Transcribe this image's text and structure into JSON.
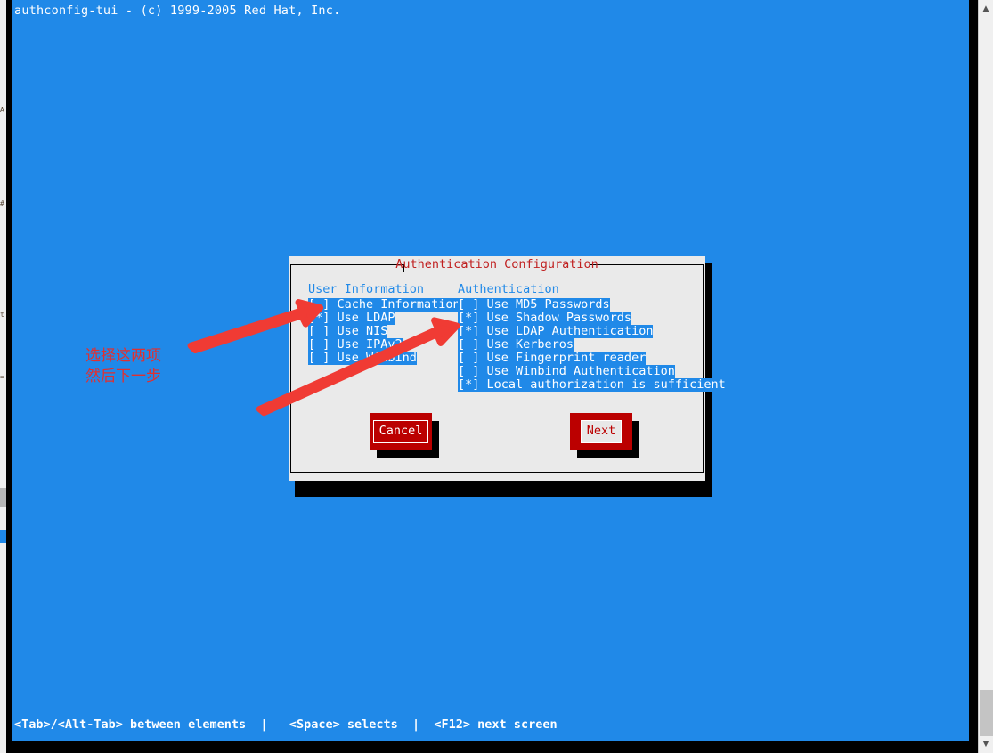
{
  "terminal": {
    "title": "authconfig-tui - (c) 1999-2005 Red Hat, Inc.",
    "status_bar": "<Tab>/<Alt-Tab> between elements  |   <Space> selects  |  <F12> next screen",
    "background_color": "#2089e8",
    "foreground_color": "#ffffff"
  },
  "dialog": {
    "title": "Authentication Configuration",
    "title_color": "#c02020",
    "background_color": "#eaeaea",
    "columns": [
      {
        "heading": "User Information",
        "options": [
          {
            "mark": "[ ]",
            "label": "Cache Information",
            "checked": false
          },
          {
            "mark": "[*]",
            "label": "Use LDAP",
            "checked": true
          },
          {
            "mark": "[ ]",
            "label": "Use NIS",
            "checked": false
          },
          {
            "mark": "[ ]",
            "label": "Use IPAv2",
            "checked": false
          },
          {
            "mark": "[ ]",
            "label": "Use Winbind",
            "checked": false
          }
        ]
      },
      {
        "heading": "Authentication",
        "options": [
          {
            "mark": "[ ]",
            "label": "Use MD5 Passwords",
            "checked": false
          },
          {
            "mark": "[*]",
            "label": "Use Shadow Passwords",
            "checked": true
          },
          {
            "mark": "[*]",
            "label": "Use LDAP Authentication",
            "checked": true
          },
          {
            "mark": "[ ]",
            "label": "Use Kerberos",
            "checked": false
          },
          {
            "mark": "[ ]",
            "label": "Use Fingerprint reader",
            "checked": false
          },
          {
            "mark": "[ ]",
            "label": "Use Winbind Authentication",
            "checked": false
          },
          {
            "mark": "[*]",
            "label": "Local authorization is sufficient",
            "checked": true
          }
        ]
      }
    ],
    "buttons": {
      "cancel_label": "Cancel",
      "next_label": "Next",
      "focused": "Next",
      "button_color": "#bb0000"
    }
  },
  "annotation": {
    "line1": "选择这两项",
    "line2": "然后下一步",
    "color": "#e03030",
    "arrow_count": 2
  },
  "scrollbar": {
    "up_arrow_icon": "chevron-up-icon",
    "down_arrow_icon": "chevron-down-icon",
    "thumb_position": "bottom"
  }
}
